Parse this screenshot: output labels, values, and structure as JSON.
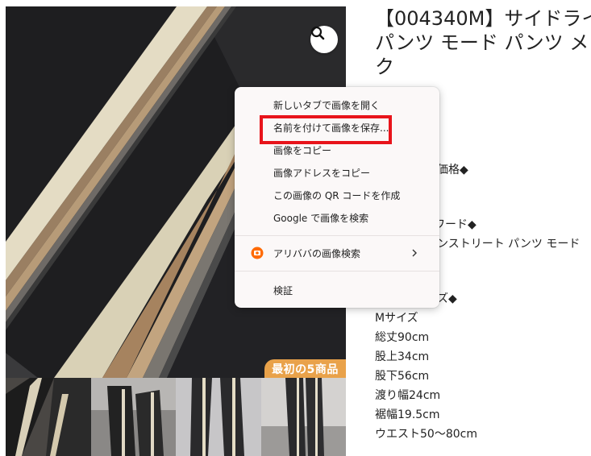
{
  "product": {
    "title_lines": [
      "【004340M】サイドライ",
      "パンツ モード パンツ メン",
      "ク"
    ],
    "partial_lines": [
      "価格◆",
      "ワード◆",
      "ンストリート パンツ モード",
      "ズ◆"
    ],
    "specs": [
      "Mサイズ",
      "総丈90cm",
      "股上34cm",
      "股下56cm",
      "渡り幅24cm",
      "裾幅19.5cm",
      "ウエスト50～80cm"
    ],
    "promo_badge": "最初の5商品"
  },
  "icons": {
    "zoom": "magnifier-icon",
    "image_search": "alibaba-image-search-icon",
    "submenu": "chevron-right-icon"
  },
  "context_menu": {
    "items": [
      "新しいタブで画像を開く",
      "名前を付けて画像を保存...",
      "画像をコピー",
      "画像アドレスをコピー",
      "この画像の QR コードを作成",
      "Google で画像を検索",
      "アリババの画像検索",
      "検証"
    ],
    "highlight_color": "#e8141b"
  },
  "colors": {
    "badge": "#e9a24a",
    "highlight": "#e8141b",
    "menu_bg": "#fbf8f8"
  }
}
